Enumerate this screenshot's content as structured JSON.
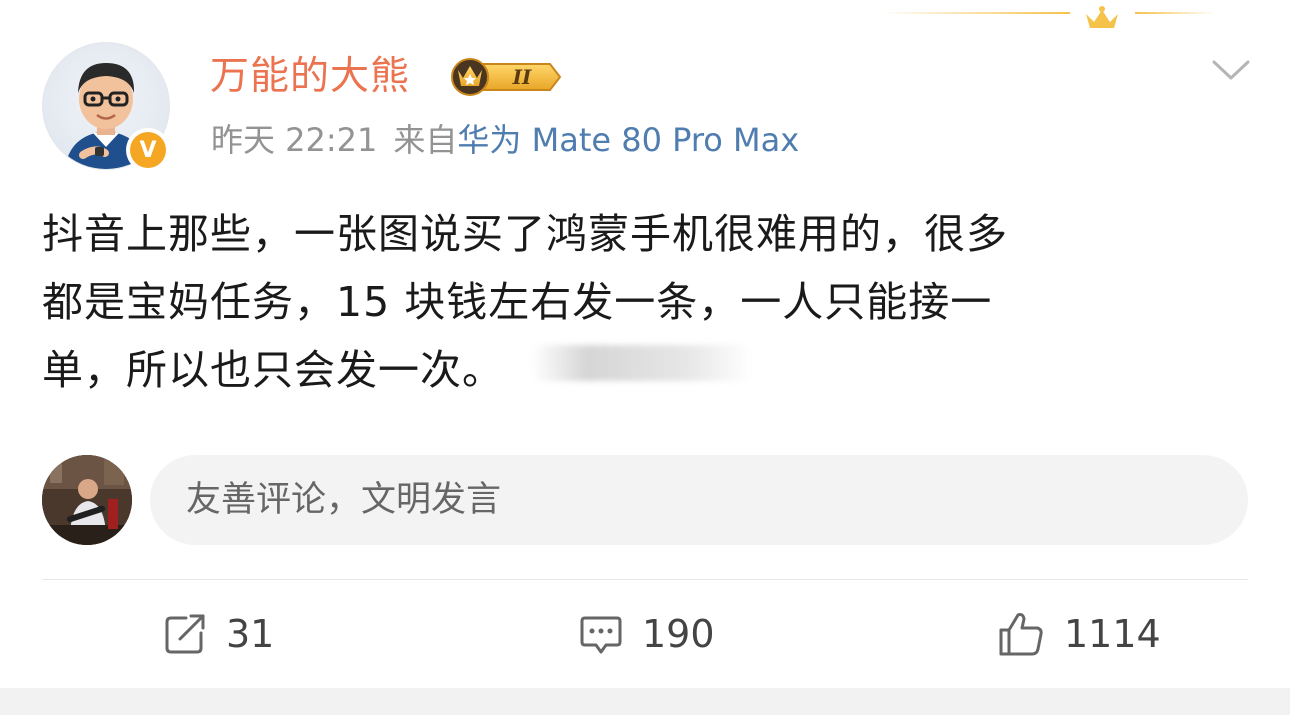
{
  "post": {
    "author": {
      "name": "万能的大熊",
      "rank_badge": "II",
      "verified_badge": "V"
    },
    "meta": {
      "time": "昨天 22:21",
      "source_prefix": "来自",
      "source": "华为 Mate 80 Pro Max"
    },
    "text_lines": [
      "抖音上那些，一张图说买了鸿蒙手机很难用的，很多",
      "都是宝妈任务，15 块钱左右发一条，一人只能接一",
      "单，所以也只会发一次。"
    ]
  },
  "comment_input": {
    "placeholder": "友善评论，文明发言"
  },
  "actions": {
    "repost": {
      "icon": "repost-icon",
      "count": "31"
    },
    "comment": {
      "icon": "comment-icon",
      "count": "190"
    },
    "like": {
      "icon": "thumbs-up-icon",
      "count": "1114"
    }
  },
  "colors": {
    "username": "#eb7350",
    "source_link": "#507daf",
    "meta": "#939393",
    "badge_gold": "#f5a623"
  }
}
